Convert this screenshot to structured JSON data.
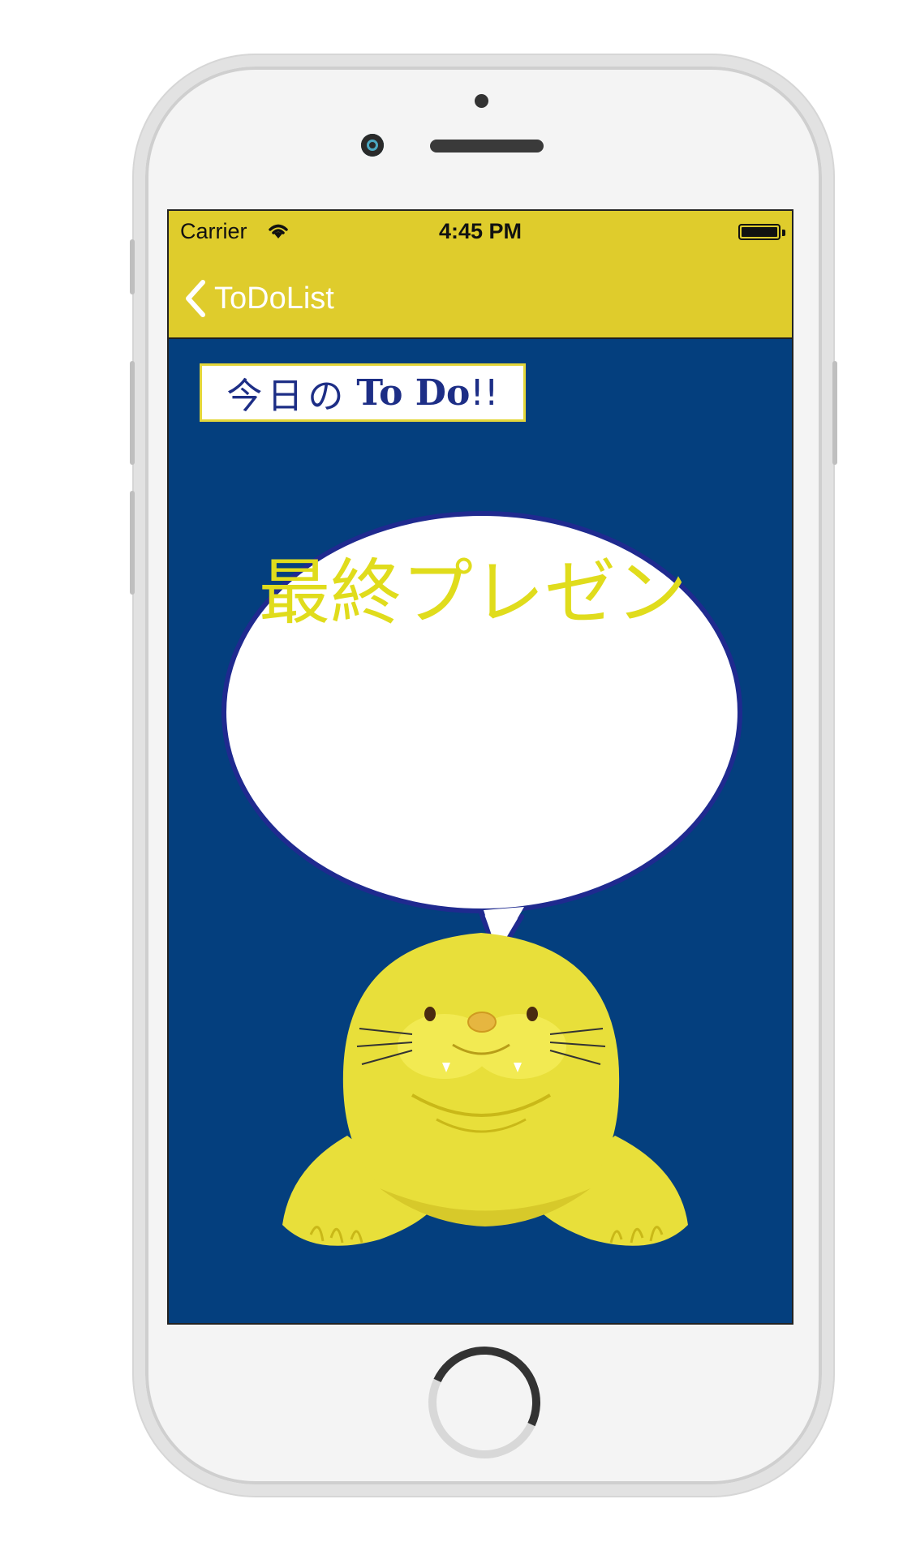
{
  "status_bar": {
    "carrier": "Carrier",
    "time": "4:45 PM"
  },
  "nav": {
    "back_label": "ToDoList"
  },
  "title": {
    "jp": "今日の",
    "en": "To Do",
    "suffix": "!!"
  },
  "bubble": {
    "text": "最終プレゼン"
  },
  "colors": {
    "nav_bar": "#dfcc2c",
    "background": "#043f7e",
    "bubble_text": "#e0dc1c",
    "seal": "#e8df3a",
    "title_text": "#1d2e86"
  },
  "icons": {
    "back": "chevron-left-icon",
    "wifi": "wifi-icon",
    "battery": "battery-icon"
  }
}
